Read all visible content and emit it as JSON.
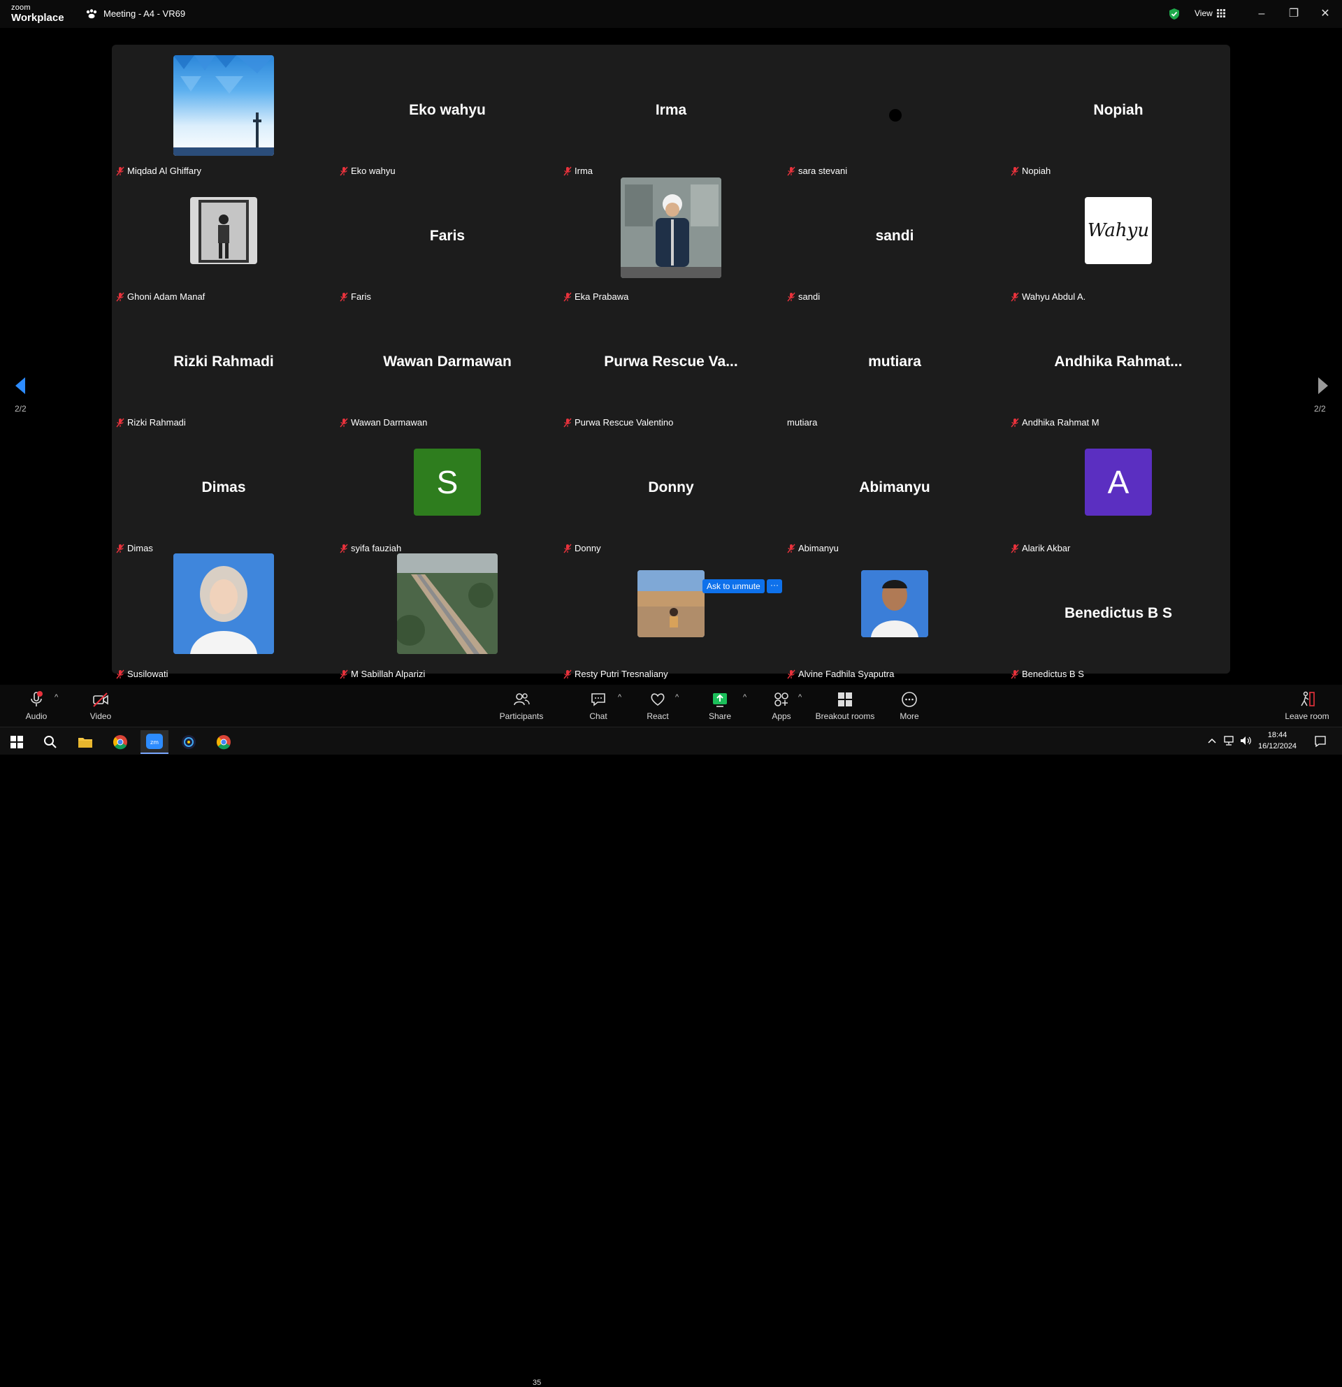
{
  "window": {
    "logo_top": "zoom",
    "logo_bottom": "Workplace",
    "meeting_title": "Meeting - A4 - VR69",
    "view_label": "View"
  },
  "gallery": {
    "page_left": "2/2",
    "page_right": "2/2",
    "ask_unmute": "Ask to unmute",
    "ask_more": "···",
    "tiles": [
      {
        "big": "",
        "label": "Miqdad Al Ghiffary"
      },
      {
        "big": "Eko wahyu",
        "label": "Eko wahyu"
      },
      {
        "big": "Irma",
        "label": "Irma"
      },
      {
        "big": "",
        "label": "sara stevani"
      },
      {
        "big": "Nopiah",
        "label": "Nopiah"
      },
      {
        "big": "",
        "label": "Ghoni Adam Manaf"
      },
      {
        "big": "Faris",
        "label": "Faris"
      },
      {
        "big": "",
        "label": "Eka Prabawa"
      },
      {
        "big": "sandi",
        "label": "sandi"
      },
      {
        "big": "",
        "label": "Wahyu Abdul A.",
        "image_text": "Wahyu"
      },
      {
        "big": "Rizki Rahmadi",
        "label": "Rizki Rahmadi"
      },
      {
        "big": "Wawan Darmawan",
        "label": "Wawan Darmawan"
      },
      {
        "big": "Purwa Rescue Va...",
        "label": "Purwa Rescue Valentino"
      },
      {
        "big": "mutiara",
        "label": "mutiara"
      },
      {
        "big": "Andhika Rahmat...",
        "label": "Andhika Rahmat M"
      },
      {
        "big": "Dimas",
        "label": "Dimas"
      },
      {
        "big": "",
        "label": "syifa fauziah",
        "letter": "S"
      },
      {
        "big": "Donny",
        "label": "Donny"
      },
      {
        "big": "Abimanyu",
        "label": "Abimanyu"
      },
      {
        "big": "",
        "label": "Alarik Akbar",
        "letter": "A"
      },
      {
        "big": "",
        "label": "Susilowati"
      },
      {
        "big": "",
        "label": "M Sabillah Alparizi"
      },
      {
        "big": "",
        "label": "Resty Putri Tresnaliany"
      },
      {
        "big": "",
        "label": "Alvine Fadhila Syaputra"
      },
      {
        "big": "Benedictus B S",
        "label": "Benedictus B S"
      }
    ]
  },
  "toolbar": {
    "audio": "Audio",
    "video": "Video",
    "participants": "Participants",
    "participants_count": "35",
    "chat": "Chat",
    "react": "React",
    "share": "Share",
    "apps": "Apps",
    "breakout": "Breakout rooms",
    "more": "More",
    "leave": "Leave room"
  },
  "taskbar": {
    "time": "18:44",
    "date": "16/12/2024"
  },
  "colors": {
    "gallery_bg": "#1c1c1c",
    "accent_blue": "#0e71eb",
    "muted_red": "#e8323c",
    "share_green": "#1bbf5a",
    "avatar_green": "#2e7d1e",
    "avatar_purple": "#5b2fc1"
  }
}
